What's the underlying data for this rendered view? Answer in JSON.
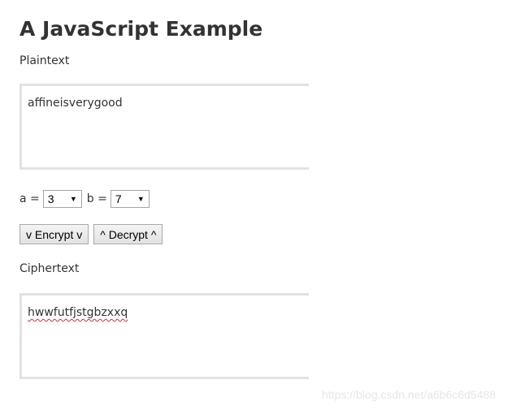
{
  "page": {
    "title": "A JavaScript Example"
  },
  "plaintext": {
    "label": "Plaintext",
    "value": "affineisverygood"
  },
  "params": {
    "a_label": "a =",
    "a_value": "3",
    "b_label": "b =",
    "b_value": "7",
    "dropdown_icon": "triangle-down-icon"
  },
  "buttons": {
    "encrypt_label": "v Encrypt v",
    "decrypt_label": "^ Decrypt ^"
  },
  "ciphertext": {
    "label": "Ciphertext",
    "value": "hwwfutfjstgbzxxq",
    "spellcheck_underline_color": "#d03030"
  },
  "watermark": {
    "text": "https://blog.csdn.net/a6b6c6d5488"
  }
}
